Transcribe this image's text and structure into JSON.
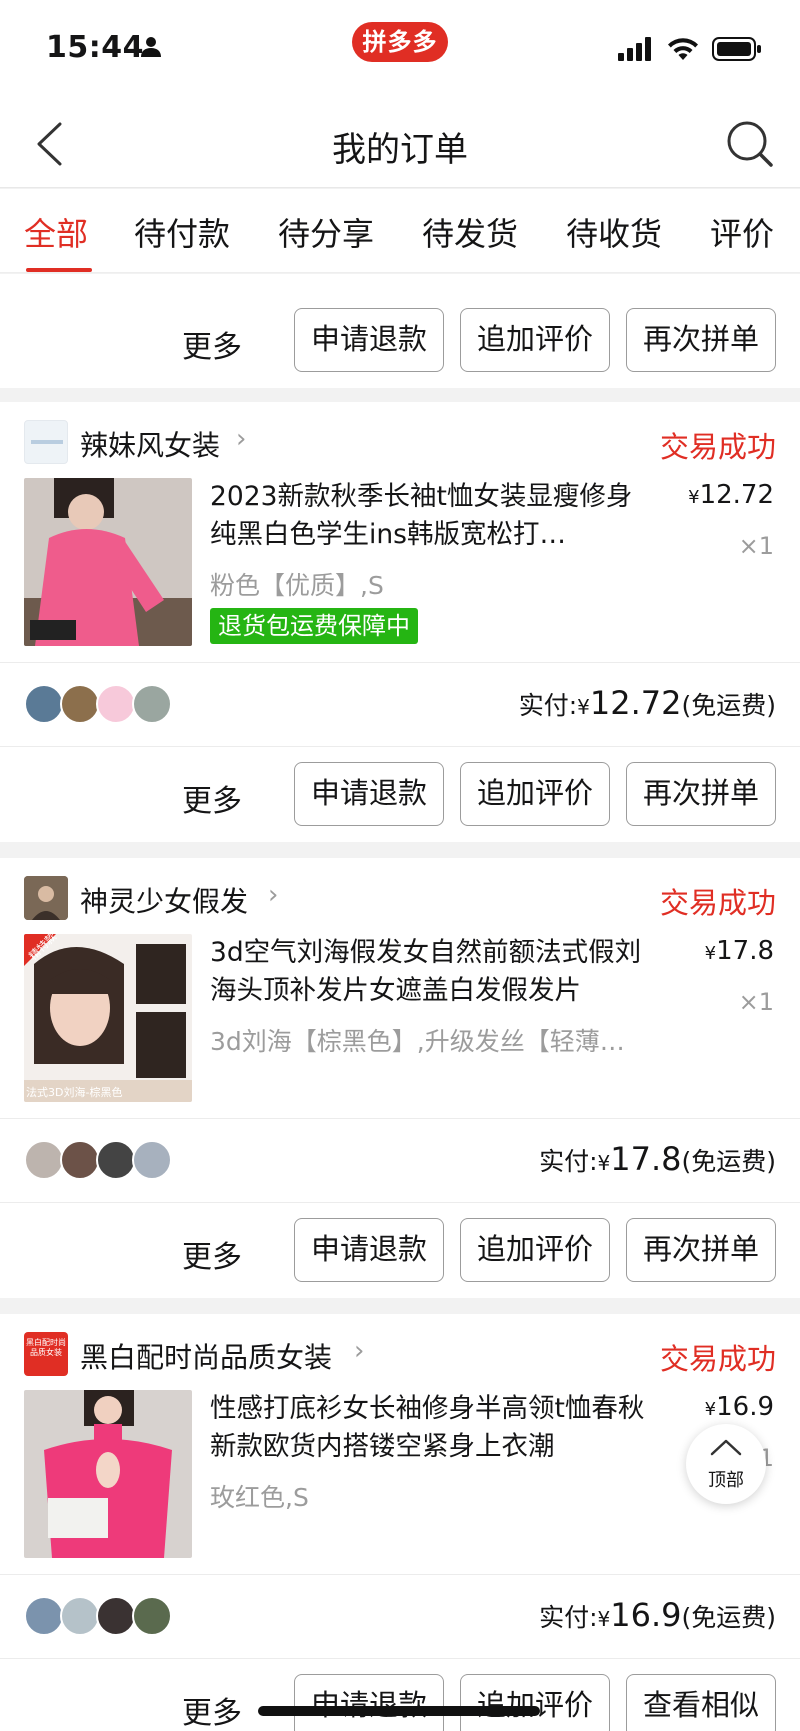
{
  "status_bar": {
    "time": "15:44",
    "app_badge": "拼多多"
  },
  "header": {
    "title": "我的订单"
  },
  "tabs": [
    {
      "label": "全部",
      "active": true
    },
    {
      "label": "待付款"
    },
    {
      "label": "待分享"
    },
    {
      "label": "待发货"
    },
    {
      "label": "待收货"
    },
    {
      "label": "评价"
    }
  ],
  "top_actions": {
    "more": "更多",
    "b1": "申请退款",
    "b2": "追加评价",
    "b3": "再次拼单"
  },
  "orders": [
    {
      "shop_name": "辣妹风女装",
      "status": "交易成功",
      "product_title": "2023新款秋季长袖t恤女装显瘦修身纯黑白色学生ins韩版宽松打…",
      "spec": "粉色【优质】,S",
      "price": "12.72",
      "price_symbol": "¥",
      "qty": "×1",
      "badge": "退货包运费保障中",
      "paid_label": "实付:",
      "paid_symbol": "¥",
      "paid_amount": "12.72",
      "shipping": "(免运费)",
      "actions": {
        "more": "更多",
        "b1": "申请退款",
        "b2": "追加评价",
        "b3": "再次拼单"
      }
    },
    {
      "shop_name": "神灵少女假发",
      "status": "交易成功",
      "product_title": "3d空气刘海假发女自然前额法式假刘海头顶补发片女遮盖白发假发片",
      "spec": "3d刘海【棕黑色】,升级发丝【轻薄…",
      "price": "17.8",
      "price_symbol": "¥",
      "qty": "×1",
      "thumb_tag": "精特款",
      "thumb_caption": "法式3D刘海-棕黑色",
      "paid_label": "实付:",
      "paid_symbol": "¥",
      "paid_amount": "17.8",
      "shipping": "(免运费)",
      "actions": {
        "more": "更多",
        "b1": "申请退款",
        "b2": "追加评价",
        "b3": "再次拼单"
      }
    },
    {
      "shop_name": "黑白配时尚品质女装",
      "status": "交易成功",
      "product_title": "性感打底衫女长袖修身半高领t恤春秋新款欧货内搭镂空紧身上衣潮",
      "spec": "玫红色,S",
      "price": "16.9",
      "price_symbol": "¥",
      "qty": "1",
      "shop_logo_text": "黑白配时尚品质女装",
      "paid_label": "实付:",
      "paid_symbol": "¥",
      "paid_amount": "16.9",
      "shipping": "(免运费)",
      "actions": {
        "more": "更多",
        "b1": "申请退款",
        "b2": "追加评价",
        "b3": "查看相似"
      }
    }
  ],
  "back_to_top": "顶部",
  "colors": {
    "accent": "#e02e24",
    "guarantee": "#25b513",
    "muted": "#9c9c9c"
  }
}
